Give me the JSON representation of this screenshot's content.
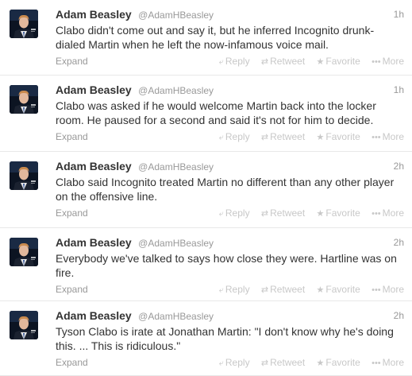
{
  "labels": {
    "expand": "Expand",
    "reply": "Reply",
    "retweet": "Retweet",
    "favorite": "Favorite",
    "more": "More"
  },
  "icons": {
    "reply": "reply-icon",
    "retweet": "retweet-icon",
    "favorite": "star-icon",
    "more": "more-dots-icon"
  },
  "colors": {
    "text": "#333333",
    "muted": "#999999",
    "action": "#c8c8c8",
    "divider": "#e8e8e8"
  },
  "tweets": [
    {
      "fullname": "Adam Beasley",
      "username": "@AdamHBeasley",
      "time": "1h",
      "text": "Clabo didn't come out and say it, but he inferred Incognito drunk-dialed Martin when he left the now-infamous voice mail."
    },
    {
      "fullname": "Adam Beasley",
      "username": "@AdamHBeasley",
      "time": "1h",
      "text": "Clabo was asked if he would welcome Martin back into the locker room. He paused for a second and said it's not for him to decide."
    },
    {
      "fullname": "Adam Beasley",
      "username": "@AdamHBeasley",
      "time": "2h",
      "text": "Clabo said Incognito treated Martin no different than any other player on the offensive line."
    },
    {
      "fullname": "Adam Beasley",
      "username": "@AdamHBeasley",
      "time": "2h",
      "text": "Everybody we've talked to says how close they were. Hartline was on fire."
    },
    {
      "fullname": "Adam Beasley",
      "username": "@AdamHBeasley",
      "time": "2h",
      "text": "Tyson Clabo is irate at Jonathan Martin: \"I don't know why he's doing this. ... This is ridiculous.\""
    }
  ]
}
